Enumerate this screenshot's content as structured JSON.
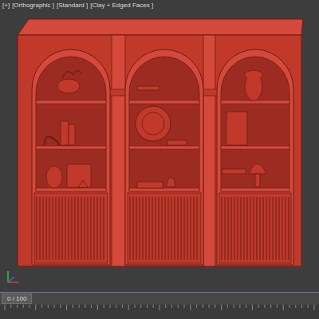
{
  "viewport": {
    "labels": [
      "[+]",
      "[Orthographic ]",
      "[Standard ]",
      "[Clay + Edged Faces ]"
    ]
  },
  "timeline": {
    "reading": "0 / 100",
    "level": 0
  }
}
